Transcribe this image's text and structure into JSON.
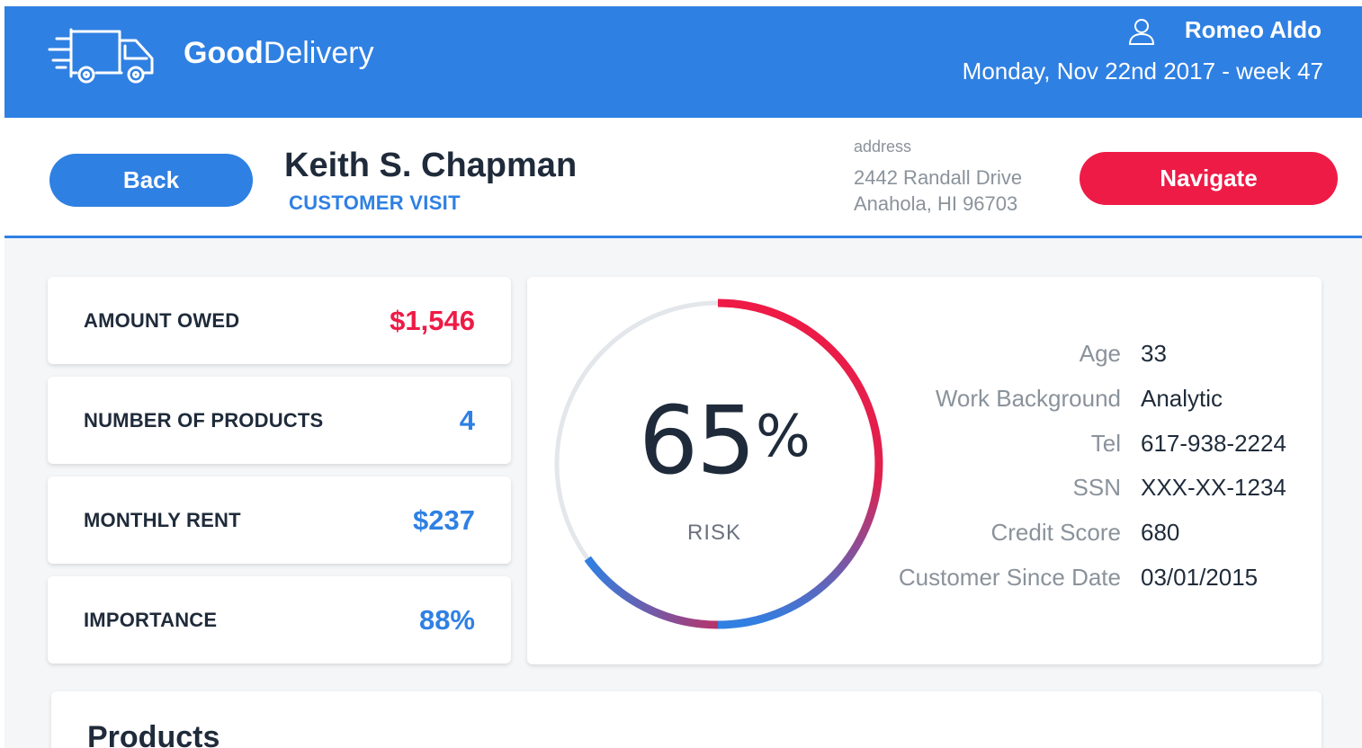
{
  "header": {
    "brand_bold": "Good",
    "brand_light": "Delivery",
    "user_name": "Romeo Aldo",
    "date_line": "Monday, Nov 22nd 2017 - week 47",
    "logo_icon": "delivery-truck-icon",
    "user_icon": "user-icon"
  },
  "customer": {
    "back_label": "Back",
    "name": "Keith S. Chapman",
    "visit_type": "CUSTOMER VISIT",
    "address_label": "address",
    "address_line1": "2442 Randall Drive",
    "address_line2": "Anahola, HI 96703",
    "navigate_label": "Navigate"
  },
  "stats": [
    {
      "label": "AMOUNT OWED",
      "value": "$1,546",
      "color": "#ee1b46"
    },
    {
      "label": "NUMBER OF PRODUCTS",
      "value": "4",
      "color": "#2f80e3"
    },
    {
      "label": "MONTHLY RENT",
      "value": "$237",
      "color": "#2f80e3"
    },
    {
      "label": "IMPORTANCE",
      "value": "88%",
      "color": "#2f80e3"
    }
  ],
  "risk": {
    "value": "65",
    "unit": "%",
    "label": "RISK",
    "fraction": 0.65
  },
  "details": [
    {
      "label": "Age",
      "value": "33"
    },
    {
      "label": "Work Background",
      "value": "Analytic"
    },
    {
      "label": "Tel",
      "value": "617-938-2224"
    },
    {
      "label": "SSN",
      "value": "XXX-XX-1234"
    },
    {
      "label": "Credit Score",
      "value": "680"
    },
    {
      "label": "Customer Since Date",
      "value": "03/01/2015"
    }
  ],
  "products": {
    "title": "Products"
  },
  "colors": {
    "primary": "#2f80e3",
    "accent": "#ee1b46",
    "track": "#e3e6ea"
  }
}
